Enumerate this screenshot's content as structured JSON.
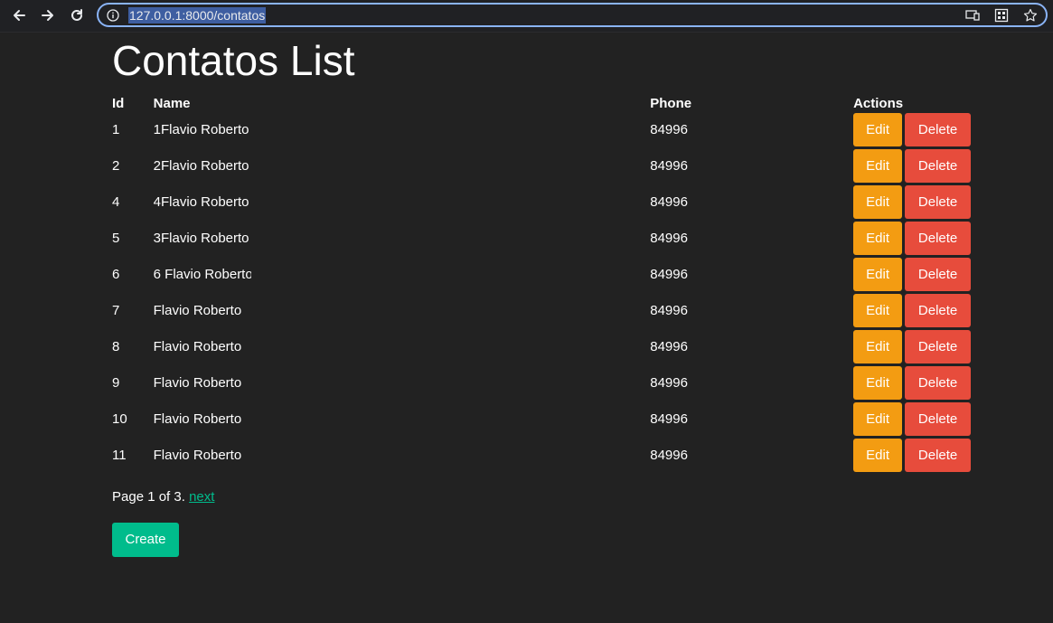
{
  "browser": {
    "url": "127.0.0.1:8000/contatos"
  },
  "page": {
    "title": "Contatos List",
    "columns": {
      "id": "Id",
      "name": "Name",
      "phone": "Phone",
      "actions": "Actions"
    },
    "rows": [
      {
        "id": "1",
        "name": "1Flavio Roberto",
        "phone": "84996"
      },
      {
        "id": "2",
        "name": "2Flavio Roberto",
        "phone": "84996"
      },
      {
        "id": "4",
        "name": "4Flavio Roberto",
        "phone": "84996"
      },
      {
        "id": "5",
        "name": "3Flavio Roberto",
        "phone": "84996"
      },
      {
        "id": "6",
        "name": "6 Flavio Roberto",
        "phone": "84996"
      },
      {
        "id": "7",
        "name": "Flavio Roberto",
        "phone": "84996"
      },
      {
        "id": "8",
        "name": "Flavio Roberto",
        "phone": "84996"
      },
      {
        "id": "9",
        "name": "Flavio Roberto",
        "phone": "84996"
      },
      {
        "id": "10",
        "name": "Flavio Roberto",
        "phone": "84996"
      },
      {
        "id": "11",
        "name": "Flavio Roberto",
        "phone": "84996"
      }
    ],
    "edit_label": "Edit",
    "delete_label": "Delete",
    "pagination_text": "Page 1 of 3.",
    "next_label": "next",
    "create_label": "Create"
  },
  "colors": {
    "background": "#222222",
    "edit": "#f39c12",
    "delete": "#e74c3c",
    "create": "#00bc8c",
    "link": "#00bc8c"
  }
}
